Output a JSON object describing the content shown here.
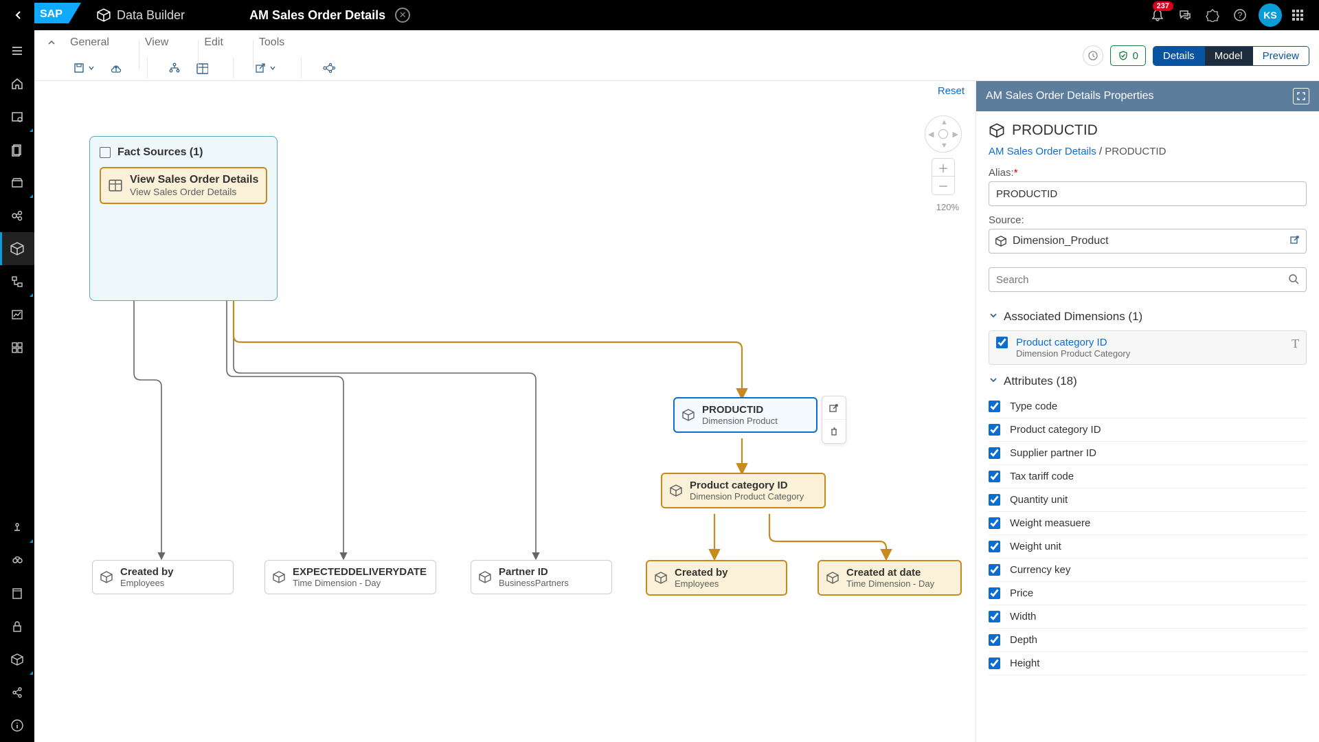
{
  "shell": {
    "logo": "SAP",
    "breadcrumb_app": "Data Builder",
    "breadcrumb_title": "AM Sales Order Details",
    "notification_count": "237",
    "avatar": "KS"
  },
  "subheader": {
    "groups": [
      "General",
      "View",
      "Edit",
      "Tools"
    ],
    "chip_count": "0",
    "segments": {
      "details": "Details",
      "model": "Model",
      "preview": "Preview"
    }
  },
  "canvas": {
    "reset": "Reset",
    "zoom_pct": "120%",
    "fact_header": "Fact Sources (1)",
    "fact_inner": {
      "title": "View Sales Order Details",
      "subtitle": "View Sales Order Details"
    },
    "nodes": {
      "productid": {
        "title": "PRODUCTID",
        "subtitle": "Dimension Product"
      },
      "prodcat": {
        "title": "Product category ID",
        "subtitle": "Dimension Product Category"
      },
      "createdby1": {
        "title": "Created by",
        "subtitle": "Employees"
      },
      "expdeliv": {
        "title": "EXPECTEDDELIVERYDATE",
        "subtitle": "Time Dimension - Day"
      },
      "partnerid": {
        "title": "Partner ID",
        "subtitle": "BusinessPartners"
      },
      "createdby2": {
        "title": "Created by",
        "subtitle": "Employees"
      },
      "createdat": {
        "title": "Created at date",
        "subtitle": "Time Dimension - Day"
      }
    }
  },
  "props": {
    "panel_title": "AM Sales Order Details Properties",
    "title": "PRODUCTID",
    "crumb_root": "AM Sales Order Details",
    "crumb_leaf": "PRODUCTID",
    "alias_label": "Alias:",
    "alias_value": "PRODUCTID",
    "source_label": "Source:",
    "source_value": "Dimension_Product",
    "search_placeholder": "Search",
    "assoc_header": "Associated Dimensions (1)",
    "assoc_item": {
      "title": "Product category ID",
      "subtitle": "Dimension Product Category"
    },
    "attr_header": "Attributes (18)",
    "attributes": [
      "Type code",
      "Product category ID",
      "Supplier partner ID",
      "Tax tariff code",
      "Quantity unit",
      "Weight measuere",
      "Weight unit",
      "Currency key",
      "Price",
      "Width",
      "Depth",
      "Height"
    ]
  }
}
